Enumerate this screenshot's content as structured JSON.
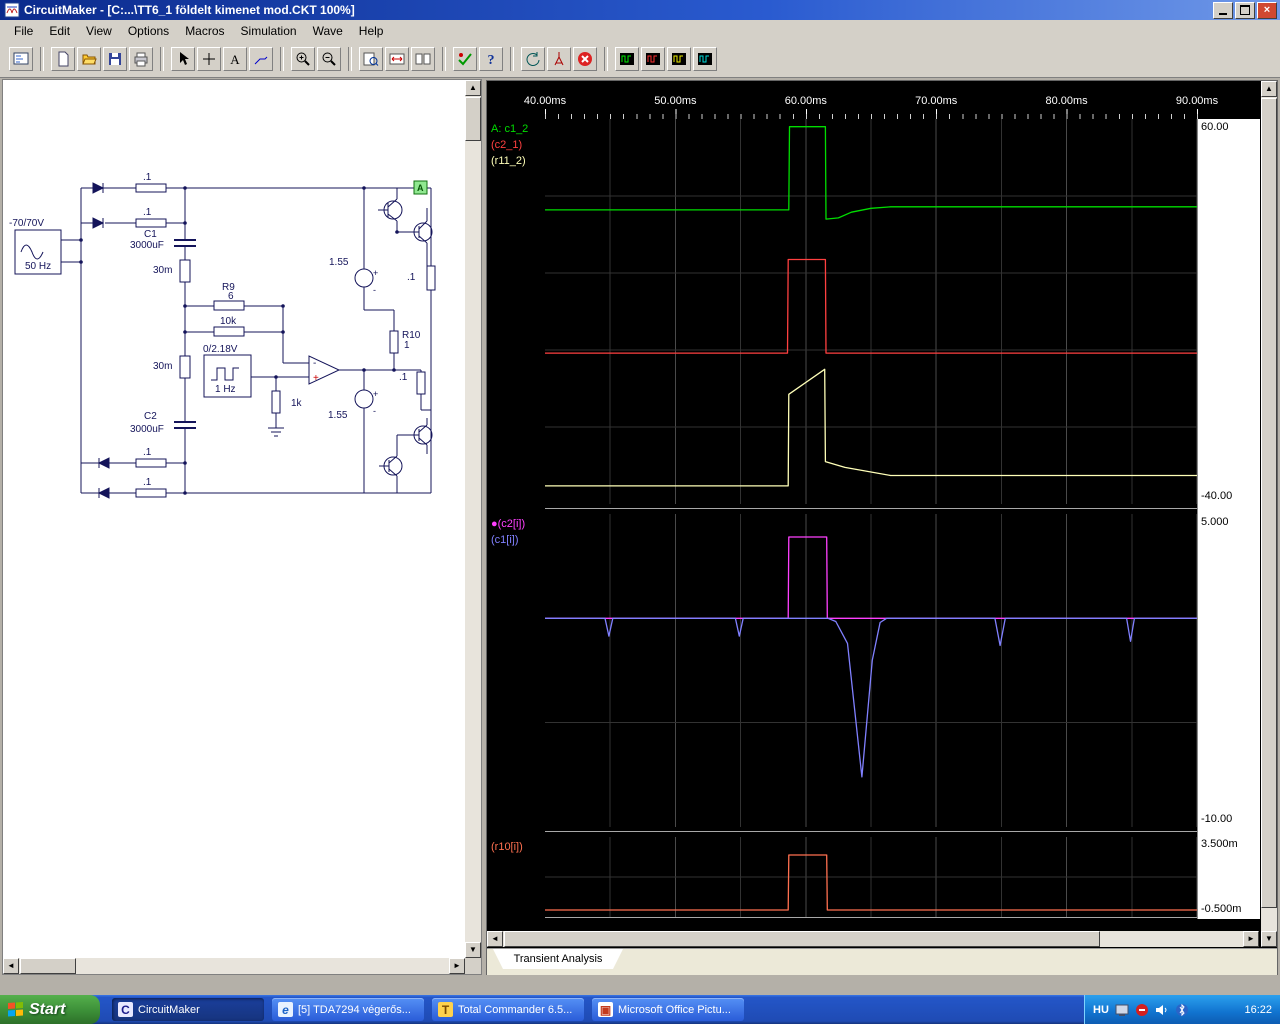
{
  "window": {
    "title": "CircuitMaker - [C:...\\TT6_1 földelt kimenet mod.CKT 100%]",
    "glyphs": {
      "close": "×",
      "up": "▲",
      "down": "▼",
      "left": "◄",
      "right": "►"
    }
  },
  "menu": {
    "items": [
      "File",
      "Edit",
      "View",
      "Options",
      "Macros",
      "Simulation",
      "Wave",
      "Help"
    ]
  },
  "toolbar": {
    "buttons": [
      "schematic-capture",
      "new",
      "open",
      "save",
      "print",
      "select",
      "place-part",
      "place-text",
      "draw-wire",
      "zoom-in",
      "zoom-out",
      "zoom-window",
      "zoom-fit",
      "split-window",
      "rules-check",
      "help",
      "rotate",
      "probe-tool",
      "stop-simulation",
      "scope-a",
      "scope-b",
      "scope-c",
      "scope-d"
    ]
  },
  "schematic": {
    "labels": {
      "src_range": "-70/70V",
      "src_freq": "50 Hz",
      "c1_name": "C1",
      "c1_val": "3000uF",
      "c2_name": "C2",
      "c2_val": "3000uF",
      "r_top1": ".1",
      "r_top2": ".1",
      "r_bot1": ".1",
      "r_bot2": ".1",
      "r_right1": ".1",
      "r_right2": ".1",
      "r_30m_1": "30m",
      "r_30m_2": "30m",
      "r9_name": "R9",
      "r9_val": "6",
      "r_10k": "10k",
      "pulse_range": "0/2.18V",
      "pulse_freq": "1 Hz",
      "r_1k": "1k",
      "v1_val": "1.55",
      "v2_val": "1.55",
      "r10_name": "R10",
      "r10_val": "1",
      "probe": "A",
      "plus": "+",
      "minus": "-"
    }
  },
  "wave": {
    "tab_label": "Transient Analysis"
  },
  "chart_data": {
    "type": "line",
    "x_unit": "ms",
    "xlim": [
      40,
      90
    ],
    "time_ticks": [
      {
        "t": 40,
        "label": "40.00ms"
      },
      {
        "t": 50,
        "label": "50.00ms"
      },
      {
        "t": 60,
        "label": "60.00ms"
      },
      {
        "t": 70,
        "label": "70.00ms"
      },
      {
        "t": 80,
        "label": "80.00ms"
      },
      {
        "t": 90,
        "label": "90.00ms"
      }
    ],
    "xgrid": [
      45,
      50,
      55,
      60,
      65,
      70,
      75,
      80,
      85,
      90
    ],
    "plots": [
      {
        "name": "output-voltages",
        "ylim": [
          -40,
          60
        ],
        "ymax_label": "60.00",
        "ymin_label": "-40.00",
        "ygrid": [
          40,
          20,
          0,
          -20
        ],
        "series": [
          {
            "label": "A: c1_2",
            "color": "#00dd00",
            "points": [
              [
                40,
                36.4
              ],
              [
                58.7,
                36.4
              ],
              [
                58.75,
                58
              ],
              [
                61.5,
                58
              ],
              [
                61.55,
                34
              ],
              [
                62.5,
                34.3
              ],
              [
                63.5,
                35.8
              ],
              [
                65,
                36.8
              ],
              [
                66.5,
                37.2
              ],
              [
                90,
                37.2
              ]
            ]
          },
          {
            "label": "(c2_1)",
            "color": "#ff4040",
            "points": [
              [
                40,
                -0.8
              ],
              [
                58.6,
                -0.8
              ],
              [
                58.65,
                23.5
              ],
              [
                61.5,
                23.5
              ],
              [
                61.55,
                -0.8
              ],
              [
                90,
                -0.8
              ]
            ]
          },
          {
            "label": "(r11_2)",
            "color": "#ffffb8",
            "points": [
              [
                40,
                -35.3
              ],
              [
                58.65,
                -35.3
              ],
              [
                58.7,
                -11.5
              ],
              [
                61.45,
                -5
              ],
              [
                61.5,
                -29
              ],
              [
                63,
                -30.5
              ],
              [
                66.5,
                -32.6
              ],
              [
                90,
                -32.6
              ]
            ]
          }
        ]
      },
      {
        "name": "capacitor-currents",
        "ylim": [
          -10,
          5
        ],
        "ymax_label": "5.000",
        "ymin_label": "-10.00",
        "ygrid": [
          0,
          -5
        ],
        "series": [
          {
            "label": "●(c2[i])",
            "color": "#ff40ff",
            "points": [
              [
                40,
                0
              ],
              [
                58.65,
                0
              ],
              [
                58.7,
                3.9
              ],
              [
                61.6,
                3.9
              ],
              [
                61.65,
                0
              ],
              [
                90,
                0
              ]
            ]
          },
          {
            "label": "(c1[i])",
            "color": "#8080ff",
            "points": [
              [
                40,
                0
              ],
              [
                44.6,
                0
              ],
              [
                44.9,
                -0.85
              ],
              [
                45.2,
                0
              ],
              [
                54.6,
                0
              ],
              [
                54.9,
                -0.85
              ],
              [
                55.2,
                0
              ],
              [
                58.6,
                0
              ],
              [
                61.7,
                0
              ],
              [
                62.3,
                -0.15
              ],
              [
                63.2,
                -1.2
              ],
              [
                64.3,
                -7.6
              ],
              [
                65.1,
                -2
              ],
              [
                65.7,
                -0.2
              ],
              [
                66.2,
                0
              ],
              [
                74.5,
                0
              ],
              [
                74.9,
                -1.3
              ],
              [
                75.3,
                0
              ],
              [
                84.6,
                0
              ],
              [
                84.9,
                -1.1
              ],
              [
                85.2,
                0
              ],
              [
                90,
                0
              ]
            ]
          }
        ]
      },
      {
        "name": "r10-current",
        "ylim": [
          -0.5,
          3.5
        ],
        "ymax_label": "3.500m",
        "ymin_label": "-0.500m",
        "ygrid": [
          1.5
        ],
        "series": [
          {
            "label": "(r10[i])",
            "color": "#ff7050",
            "points": [
              [
                40,
                -0.15
              ],
              [
                58.65,
                -0.15
              ],
              [
                58.7,
                2.6
              ],
              [
                61.6,
                2.6
              ],
              [
                61.65,
                -0.15
              ],
              [
                90,
                -0.15
              ]
            ]
          }
        ]
      }
    ]
  },
  "taskbar": {
    "start_label": "Start",
    "items": [
      {
        "label": "CircuitMaker"
      },
      {
        "label": "[5] TDA7294 végerős..."
      },
      {
        "label": "Total Commander 6.5..."
      },
      {
        "label": "Microsoft Office Pictu..."
      }
    ],
    "language": "HU",
    "time": "16:22"
  }
}
